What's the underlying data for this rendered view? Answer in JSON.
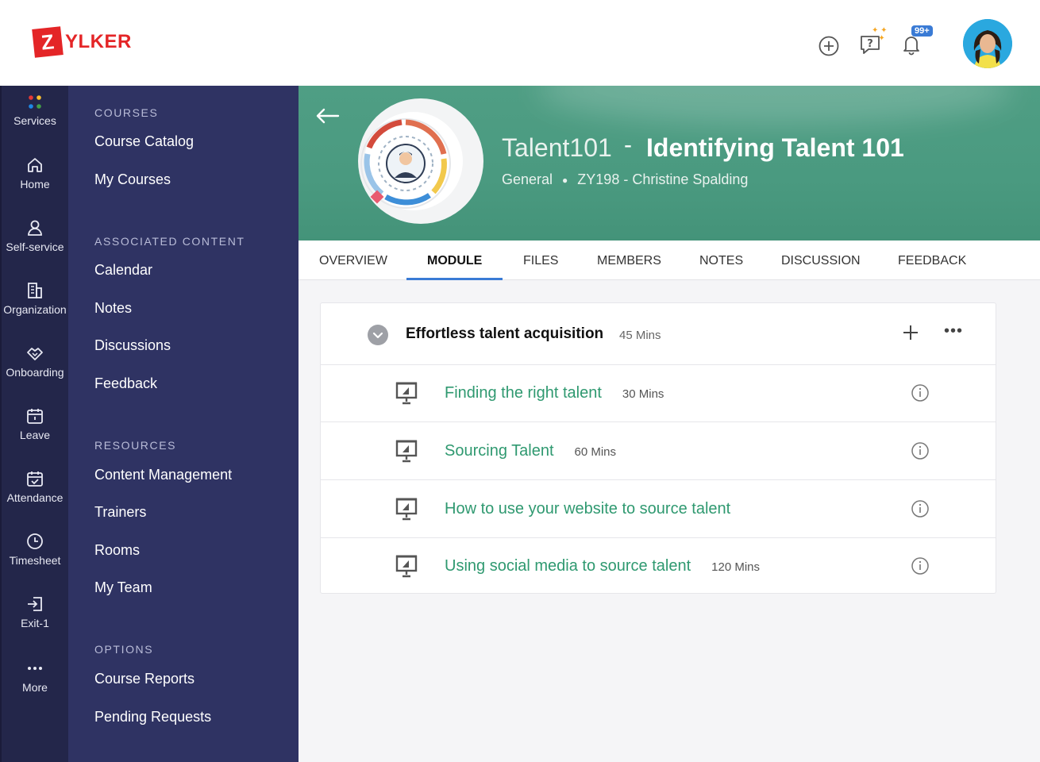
{
  "brand": {
    "logo_letter": "Z",
    "logo_text": "YLKER",
    "color": "#e42527"
  },
  "topbar": {
    "icons": [
      "add-circle-icon",
      "help-chat-icon",
      "notification-bell-icon"
    ],
    "notification_badge": "99+"
  },
  "rail": {
    "items": [
      {
        "label": "Services",
        "icon": "services-dots-icon"
      },
      {
        "label": "Home",
        "icon": "home-icon"
      },
      {
        "label": "Self-service",
        "icon": "user-icon"
      },
      {
        "label": "Organization",
        "icon": "building-icon"
      },
      {
        "label": "Onboarding",
        "icon": "handshake-icon"
      },
      {
        "label": "Leave",
        "icon": "calendar-icon"
      },
      {
        "label": "Attendance",
        "icon": "calendar-check-icon"
      },
      {
        "label": "Timesheet",
        "icon": "clock-icon"
      },
      {
        "label": "Exit-1",
        "icon": "exit-icon"
      },
      {
        "label": "More",
        "icon": "more-dots-icon"
      }
    ]
  },
  "sidebar": {
    "sections": [
      {
        "title": "COURSES",
        "items": [
          "Course Catalog",
          "My Courses"
        ]
      },
      {
        "title": "ASSOCIATED CONTENT",
        "items": [
          "Calendar",
          "Notes",
          "Discussions",
          "Feedback"
        ]
      },
      {
        "title": "RESOURCES",
        "items": [
          "Content Management",
          "Trainers",
          "Rooms",
          "My Team"
        ]
      },
      {
        "title": "OPTIONS",
        "items": [
          "Course Reports",
          "Pending Requests"
        ]
      }
    ]
  },
  "course": {
    "code": "Talent101",
    "separator": "-",
    "name": "Identifying Talent 101",
    "category": "General",
    "instructor": "ZY198 - Christine Spalding"
  },
  "tabs": {
    "items": [
      "OVERVIEW",
      "MODULE",
      "FILES",
      "MEMBERS",
      "NOTES",
      "DISCUSSION",
      "FEEDBACK"
    ],
    "active": "MODULE"
  },
  "module": {
    "title": "Effortless talent acquisition",
    "duration": "45 Mins",
    "lessons": [
      {
        "title": "Finding the right talent",
        "duration": "30 Mins"
      },
      {
        "title": "Sourcing Talent",
        "duration": "60 Mins"
      },
      {
        "title": "How to use your website to source talent",
        "duration": ""
      },
      {
        "title": "Using social media to source talent",
        "duration": "120 Mins"
      }
    ]
  }
}
